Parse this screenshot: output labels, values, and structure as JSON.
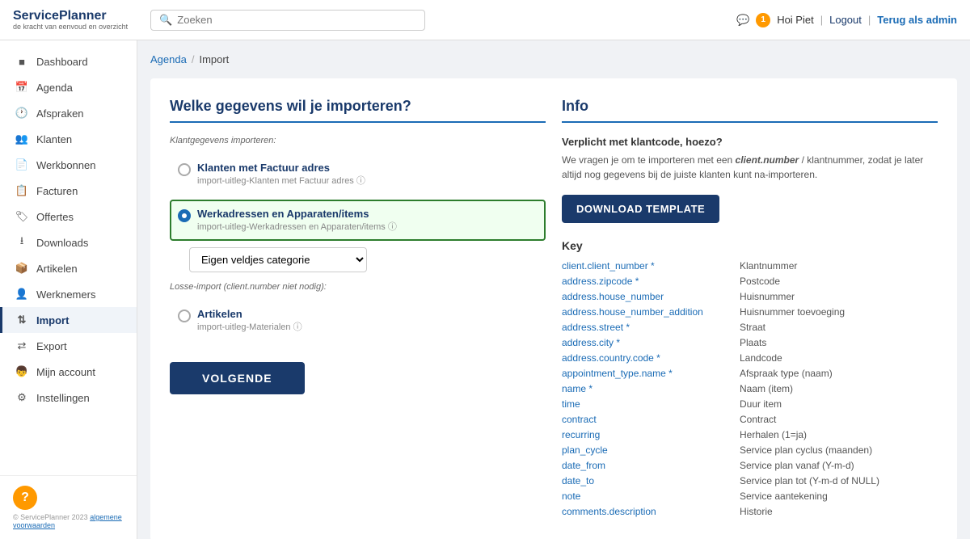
{
  "header": {
    "logo_text": "ServicePlanner",
    "logo_sub": "de kracht van eenvoud en overzicht",
    "search_placeholder": "Zoeken",
    "notif_count": "1",
    "user": "Hoi Piet",
    "logout": "Logout",
    "admin_link": "Terug als admin"
  },
  "sidebar": {
    "items": [
      {
        "id": "dashboard",
        "label": "Dashboard",
        "icon": "grid"
      },
      {
        "id": "agenda",
        "label": "Agenda",
        "icon": "calendar"
      },
      {
        "id": "afspraken",
        "label": "Afspraken",
        "icon": "clock"
      },
      {
        "id": "klanten",
        "label": "Klanten",
        "icon": "users"
      },
      {
        "id": "werkbonnen",
        "label": "Werkbonnen",
        "icon": "file"
      },
      {
        "id": "facturen",
        "label": "Facturen",
        "icon": "receipt"
      },
      {
        "id": "offertes",
        "label": "Offertes",
        "icon": "tag"
      },
      {
        "id": "downloads",
        "label": "Downloads",
        "icon": "download"
      },
      {
        "id": "artikelen",
        "label": "Artikelen",
        "icon": "box"
      },
      {
        "id": "werknemers",
        "label": "Werknemers",
        "icon": "person"
      },
      {
        "id": "import",
        "label": "Import",
        "icon": "import",
        "active": true
      },
      {
        "id": "export",
        "label": "Export",
        "icon": "export"
      },
      {
        "id": "mijn_account",
        "label": "Mijn account",
        "icon": "account"
      },
      {
        "id": "instellingen",
        "label": "Instellingen",
        "icon": "settings"
      }
    ]
  },
  "breadcrumb": {
    "parent": "Agenda",
    "sep": "/",
    "current": "Import"
  },
  "left_panel": {
    "title": "Welke gegevens wil je importeren?",
    "klant_label": "Klantgegevens importeren:",
    "options": [
      {
        "id": "klanten_factuur",
        "label": "Klanten met Factuur adres",
        "sub": "import-uitleg-Klanten met Factuur adres",
        "checked": false
      },
      {
        "id": "werkadressen",
        "label": "Werkadressen en Apparaten/items",
        "sub": "import-uitleg-Werkadressen en Apparaten/items",
        "checked": true
      }
    ],
    "dropdown_value": "Eigen veldjes categorie",
    "dropdown_options": [
      "Eigen veldjes categorie"
    ],
    "losse_label": "Losse-import (client.number niet nodig):",
    "artikelen_label": "Artikelen",
    "artikelen_sub": "import-uitleg-Materialen",
    "volgende": "VOLGENDE"
  },
  "right_panel": {
    "title": "Info",
    "verplicht_title": "Verplicht met klantcode, hoezo?",
    "verplicht_text1": "We vragen je om te importeren met een ",
    "verplicht_bold": "client.number",
    "verplicht_text2": " / klantnummer, zodat je later altijd nog gegevens bij de juiste klanten kunt na-importeren.",
    "download_btn": "DOWNLOAD TEMPLATE",
    "key_title": "Key",
    "key_items": [
      {
        "field": "client.client_number *",
        "desc": "Klantnummer"
      },
      {
        "field": "address.zipcode *",
        "desc": "Postcode"
      },
      {
        "field": "address.house_number",
        "desc": "Huisnummer"
      },
      {
        "field": "address.house_number_addition",
        "desc": "Huisnummer toevoeging"
      },
      {
        "field": "address.street *",
        "desc": "Straat"
      },
      {
        "field": "address.city *",
        "desc": "Plaats"
      },
      {
        "field": "address.country.code *",
        "desc": "Landcode"
      },
      {
        "field": "appointment_type.name *",
        "desc": "Afspraak type (naam)"
      },
      {
        "field": "name *",
        "desc": "Naam (item)"
      },
      {
        "field": "time",
        "desc": "Duur item"
      },
      {
        "field": "contract",
        "desc": "Contract"
      },
      {
        "field": "recurring",
        "desc": "Herhalen (1=ja)"
      },
      {
        "field": "plan_cycle",
        "desc": "Service plan cyclus (maanden)"
      },
      {
        "field": "date_from",
        "desc": "Service plan vanaf (Y-m-d)"
      },
      {
        "field": "date_to",
        "desc": "Service plan tot (Y-m-d of NULL)"
      },
      {
        "field": "note",
        "desc": "Service aantekening"
      },
      {
        "field": "comments.description",
        "desc": "Historie"
      }
    ]
  },
  "footer": {
    "copyright": "© ServicePlanner 2023",
    "link": "algemene voorwaarden"
  }
}
